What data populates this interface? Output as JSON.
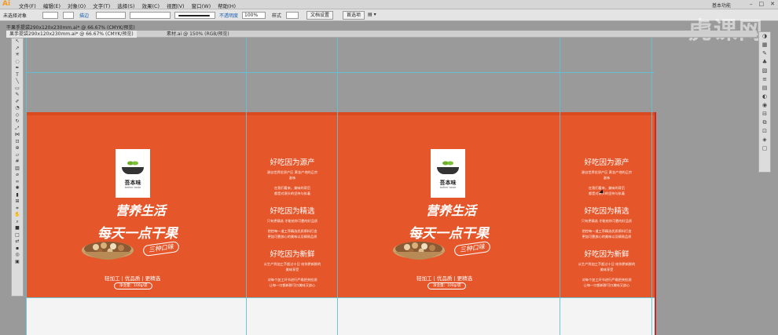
{
  "app": {
    "logo": "Ai"
  },
  "menu": [
    "文件(F)",
    "编辑(E)",
    "对象(O)",
    "文字(T)",
    "选择(S)",
    "效果(C)",
    "视图(V)",
    "窗口(W)",
    "帮助(H)"
  ],
  "workspace": "基本功能",
  "window_controls": [
    "–",
    "□",
    "✕"
  ],
  "controlbar": {
    "selection": "未选择对象",
    "stroke_label": "描边",
    "opacity_label": "不透明度",
    "opacity_value": "100%",
    "style_label": "样式",
    "doc_setup": "文档设置",
    "preferences": "首选项"
  },
  "tabs_row1": [
    "干果手提袋290x120x230mm.ai* @ 66.67% (CMYK/预览)"
  ],
  "tabs_row2": [
    "果手提袋290x120x230mm.ai* @ 66.67% (CMYK/预览)",
    "素材.ai @ 150% (RGB/预览)"
  ],
  "watermark": "虎课网",
  "bag": {
    "brand": "吾本味",
    "brand_sub": "better taste",
    "slogan_line1": "营养生活",
    "slogan_line2": "每天一点干果",
    "stamp": "三种口味",
    "tagline": "轻加工 | 优品质 | 更精选",
    "net_weight": "净含量：100g/袋",
    "side_blocks": [
      {
        "heading": "好吃因为源产",
        "body": "源自世界优质产区 黄金产地的正宗\n滋味"
      },
      {
        "heading": "",
        "body": "在我们看来，美味的背后\n都是对源头的坚持与执着"
      },
      {
        "heading": "好吃因为精选",
        "body": "只有更精选 才能给你可靠的好品质"
      },
      {
        "heading": "",
        "body": "把控每一道工序精选优质原料打造\n更加可靠放心的美味以及精致品质"
      },
      {
        "heading": "好吃因为新鲜",
        "body": "从生产到加工不超过十日 给你更新鲜的\n美味享受"
      },
      {
        "heading": "",
        "body": "对每个加工环节进行严格把关检测\n让每一口都新鲜可口美味又放心"
      }
    ]
  }
}
